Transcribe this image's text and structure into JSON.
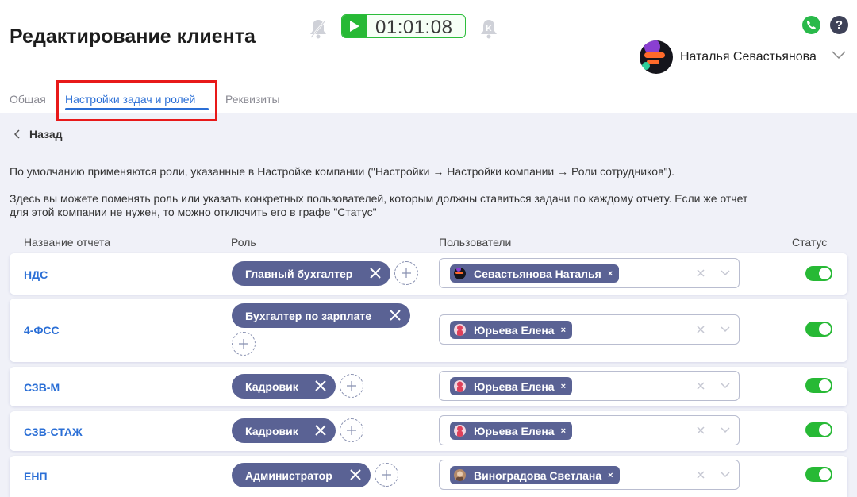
{
  "header": {
    "title": "Редактирование клиента",
    "timer": "01:01:08",
    "user_name": "Наталья Севастьянова"
  },
  "tabs": [
    {
      "label": "Общая",
      "active": false
    },
    {
      "label": "Настройки задач и ролей",
      "active": true
    },
    {
      "label": "Реквизиты",
      "active": false
    }
  ],
  "back_label": "Назад",
  "description": {
    "line1": "По умолчанию применяются роли, указанные в Настройке компании (\"Настройки → Настройки компании → Роли сотрудников\").",
    "line2a": "Здесь вы можете поменять роль или указать конкретных пользователей, которым должны ставиться задачи по каждому отчету. Если же отчет",
    "line2b": "для этой компании не нужен, то можно отключить его в графе \"Статус\""
  },
  "columns": {
    "report": "Название отчета",
    "role": "Роль",
    "users": "Пользователи",
    "status": "Статус"
  },
  "rows": [
    {
      "report": "НДС",
      "role": "Главный бухгалтер",
      "user": "Севастьянова Наталья",
      "status": true
    },
    {
      "report": "4-ФСС",
      "role": "Бухгалтер по зарплате",
      "user": "Юрьева Елена",
      "status": true
    },
    {
      "report": "СЗВ-М",
      "role": "Кадровик",
      "user": "Юрьева Елена",
      "status": true
    },
    {
      "report": "СЗВ-СТАЖ",
      "role": "Кадровик",
      "user": "Юрьева Елена",
      "status": true
    },
    {
      "report": "ЕНП",
      "role": "Администратор",
      "user": "Виноградова Светлана",
      "status": true
    }
  ],
  "colors": {
    "accent": "#2b6fd6",
    "chip": "#5a6294",
    "toggle_on": "#27b935",
    "highlight": "#e81919"
  }
}
